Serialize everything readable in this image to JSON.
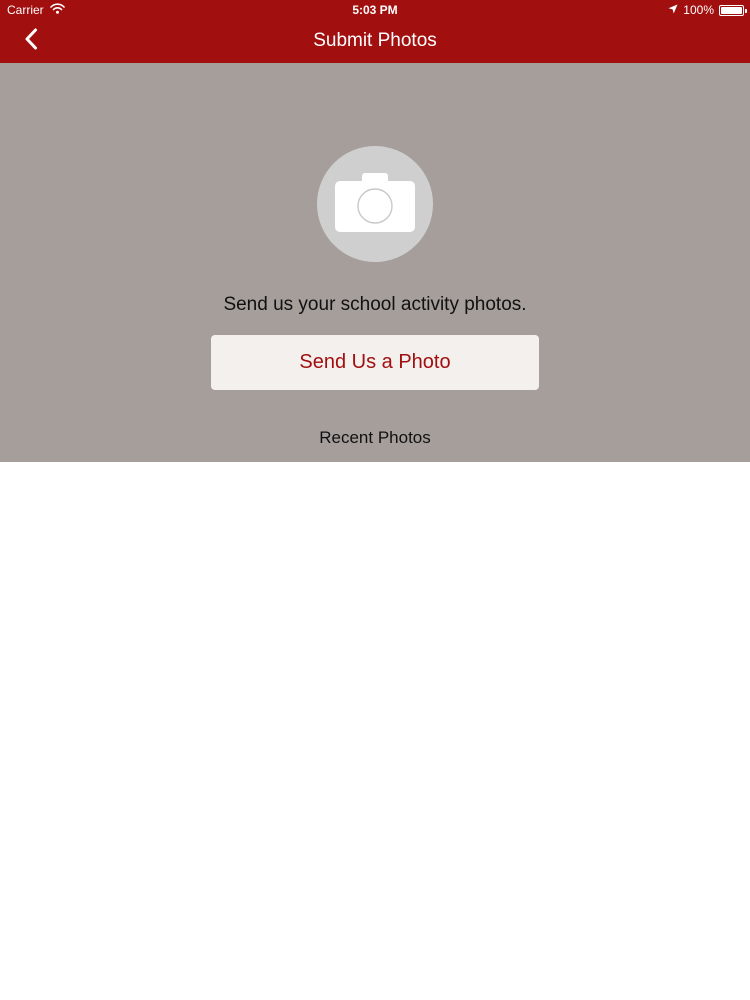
{
  "status_bar": {
    "carrier": "Carrier",
    "time": "5:03 PM",
    "battery": "100%",
    "battery_level": 1.0,
    "icons": [
      "wifi-icon",
      "location-arrow-icon",
      "battery-icon"
    ]
  },
  "nav": {
    "title": "Submit Photos",
    "back_icon": "chevron-left-icon"
  },
  "hero": {
    "icon": "camera-icon",
    "message": "Send us your school activity photos.",
    "button_label": "Send Us a Photo",
    "recent_heading": "Recent Photos"
  },
  "recent_photos": [],
  "colors": {
    "brand_red": "#a10f0f",
    "hero_grey": "#a59e9b",
    "icon_circle": "#d0cfcf",
    "button_bg": "#f4f0ee"
  }
}
